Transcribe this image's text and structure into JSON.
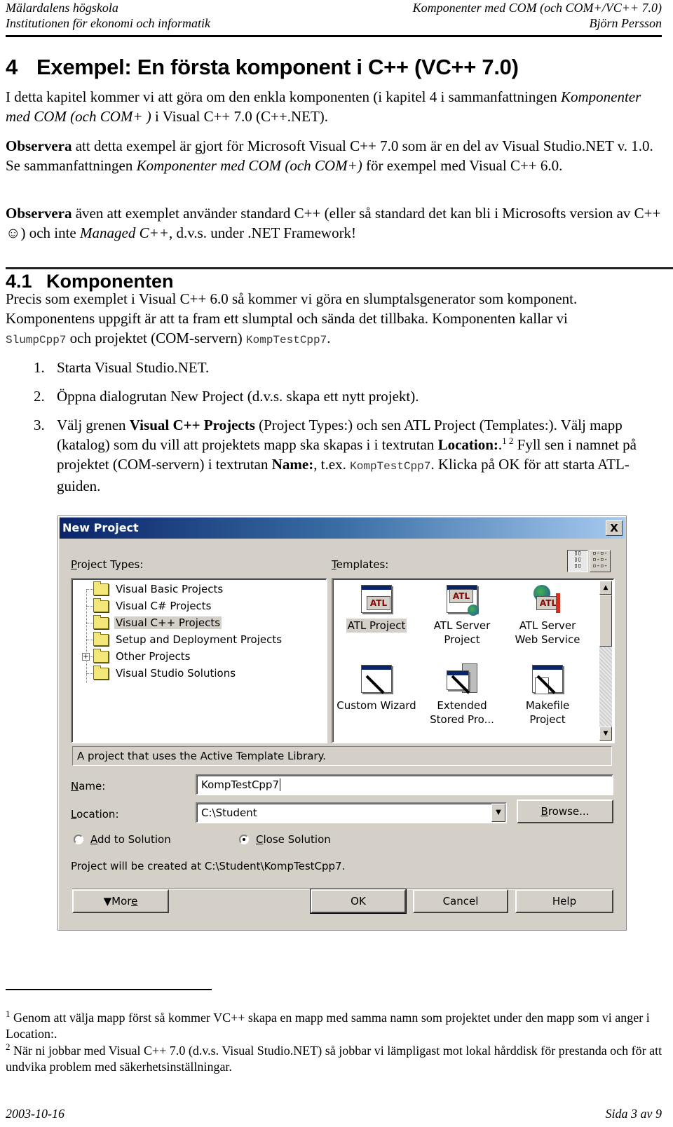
{
  "header": {
    "left_line1": "Mälardalens högskola",
    "left_line2": "Institutionen för ekonomi och informatik",
    "right_line1": "Komponenter med COM  (och COM+/VC++ 7.0)",
    "right_line2": "Björn Persson"
  },
  "chapter": {
    "number": "4",
    "title": "Exempel: En första komponent i C++ (VC++ 7.0)"
  },
  "intro": {
    "p1_a": "I detta kapitel kommer vi att göra om den enkla komponenten (i kapitel 4 i sammanfattningen ",
    "p1_italic": "Komponenter med COM (och COM+ )",
    "p1_b": " i Visual C++ 7.0 (C++.NET).",
    "p2_bold": "Observera",
    "p2_a": " att detta exempel är gjort för Microsoft Visual C++ 7.0 som är en del av Visual Studio.NET v. 1.0. Se sammanfattningen ",
    "p2_italic": "Komponenter med COM (och COM+)",
    "p2_b": " för exempel med Visual C++ 6.0.",
    "p3_bold": "Observera",
    "p3_a": " även att exemplet använder standard C++ (eller så standard det kan bli i Microsofts version av C++ ",
    "p3_smiley": "☺",
    "p3_b": ") och inte ",
    "p3_italic": "Managed C++",
    "p3_c": ", d.v.s. under .NET Framework!"
  },
  "section": {
    "number": "4.1",
    "title": "Komponenten",
    "p_a": "Precis som exemplet i Visual C++ 6.0 så kommer vi göra en slumptalsgenerator som komponent. Komponentens uppgift är att ta fram ett slumptal och sända det tillbaka. Komponenten kallar vi ",
    "p_code1": "SlumpCpp7",
    "p_b": " och projektet (COM-servern) ",
    "p_code2": "KompTestCpp7",
    "p_c": "."
  },
  "steps": [
    {
      "num": "1.",
      "text": "Starta Visual Studio.NET."
    },
    {
      "num": "2.",
      "text": "Öppna dialogrutan New Project (d.v.s. skapa ett nytt projekt)."
    },
    {
      "num": "3.",
      "a": "Välj grenen ",
      "bold1": "Visual C++ Projects",
      "b": " (Project Types:) och sen ATL Project (Templates:). Välj mapp (katalog) som du vill att projektets mapp ska skapas i i textrutan ",
      "bold2": "Location:",
      "c": ".",
      "sup": "1 2",
      "d": " Fyll sen i namnet på projektet (COM-servern) i textrutan ",
      "bold3": "Name:",
      "e": ", t.ex. ",
      "code": "KompTestCpp7",
      "f": ". Klicka på OK för att starta ATL- guiden."
    }
  ],
  "dialog": {
    "title": "New Project",
    "close_glyph": "X",
    "project_types_label_u": "P",
    "project_types_label": "roject Types:",
    "templates_label_u": "T",
    "templates_label": "emplates:",
    "project_types": [
      {
        "label": "Visual Basic Projects",
        "selected": false,
        "expandable": false
      },
      {
        "label": "Visual C# Projects",
        "selected": false,
        "expandable": false
      },
      {
        "label": "Visual C++ Projects",
        "selected": true,
        "expandable": false
      },
      {
        "label": "Setup and Deployment Projects",
        "selected": false,
        "expandable": false
      },
      {
        "label": "Other Projects",
        "selected": false,
        "expandable": true
      },
      {
        "label": "Visual Studio Solutions",
        "selected": false,
        "expandable": false
      }
    ],
    "plus_glyph": "+",
    "templates": [
      {
        "line1": "ATL Project",
        "line2": "",
        "icon": "atl-project-icon",
        "selected": true
      },
      {
        "line1": "ATL Server",
        "line2": "Project",
        "icon": "atl-server-project-icon",
        "selected": false
      },
      {
        "line1": "ATL Server",
        "line2": "Web Service",
        "icon": "atl-server-web-service-icon",
        "selected": false
      },
      {
        "line1": "Custom Wizard",
        "line2": "",
        "icon": "custom-wizard-icon",
        "selected": false
      },
      {
        "line1": "Extended",
        "line2": "Stored Pro...",
        "icon": "extended-stored-procedure-icon",
        "selected": false
      },
      {
        "line1": "Makefile Project",
        "line2": "",
        "icon": "makefile-project-icon",
        "selected": false
      }
    ],
    "atl_badge": "ATL",
    "large_icons_glyph": "▯▯\n▯▯\n▯▯",
    "small_icons_glyph": "▫-▫-\n▫-▫-\n▫-▫-",
    "scroll_up_glyph": "▲",
    "scroll_down_glyph": "▼",
    "description": "A project that uses the Active Template Library.",
    "name_label_u": "N",
    "name_label": "ame:",
    "name_value": "KompTestCpp7",
    "location_label_u": "L",
    "location_label": "ocation:",
    "location_value": "C:\\Student",
    "dropdown_glyph": "▼",
    "browse_u": "B",
    "browse_label": "rowse...",
    "add_to_solution_u": "A",
    "add_to_solution": "dd to Solution",
    "add_to_solution_checked": false,
    "close_solution_u": "C",
    "close_solution": "lose Solution",
    "close_solution_checked": true,
    "created_at": "Project will be created at C:\\Student\\KompTestCpp7.",
    "more_label": "▼Mor",
    "more_u": "e",
    "ok_label": "OK",
    "cancel_label": "Cancel",
    "help_label": "Help"
  },
  "footnotes": [
    {
      "num": "1",
      "text": " Genom att välja mapp först så kommer VC++ skapa en mapp med samma namn som projektet under den mapp som vi anger i Location:."
    },
    {
      "num": "2",
      "text": " När ni jobbar med Visual C++ 7.0 (d.v.s. Visual Studio.NET) så jobbar vi lämpligast mot lokal hårddisk för prestanda och för att undvika problem med säkerhetsinställningar."
    }
  ],
  "footer": {
    "date": "2003-10-16",
    "page": "Sida 3 av 9"
  }
}
